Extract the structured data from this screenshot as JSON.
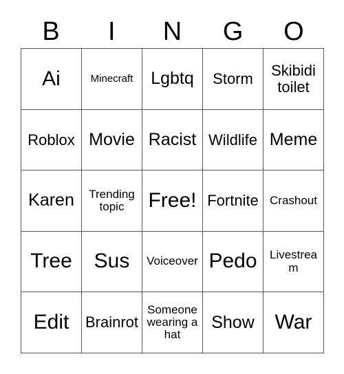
{
  "card": {
    "header_letters": [
      "B",
      "I",
      "N",
      "G",
      "O"
    ],
    "free_space_label": "Free!",
    "colors": {
      "grid_line": "#555555",
      "text": "#000000",
      "background": "#ffffff"
    },
    "rows": [
      [
        {
          "label": "Ai",
          "size": "fs-xl"
        },
        {
          "label": "Minecraft",
          "size": "fs-xs"
        },
        {
          "label": "Lgbtq",
          "size": "fs-lg"
        },
        {
          "label": "Storm",
          "size": "fs-md"
        },
        {
          "label": "Skibidi toilet",
          "size": "fs-md"
        }
      ],
      [
        {
          "label": "Roblox",
          "size": "fs-md"
        },
        {
          "label": "Movie",
          "size": "fs-lg"
        },
        {
          "label": "Racist",
          "size": "fs-lg"
        },
        {
          "label": "Wildlife",
          "size": "fs-md"
        },
        {
          "label": "Meme",
          "size": "fs-lg"
        }
      ],
      [
        {
          "label": "Karen",
          "size": "fs-lg"
        },
        {
          "label": "Trending topic",
          "size": "fs-sm"
        },
        {
          "label": "Free!",
          "size": "fs-xl"
        },
        {
          "label": "Fortnite",
          "size": "fs-md"
        },
        {
          "label": "Crashout",
          "size": "fs-sm"
        }
      ],
      [
        {
          "label": "Tree",
          "size": "fs-xl"
        },
        {
          "label": "Sus",
          "size": "fs-xl"
        },
        {
          "label": "Voiceover",
          "size": "fs-sm"
        },
        {
          "label": "Pedo",
          "size": "fs-xl"
        },
        {
          "label": "Livestream",
          "size": "fs-sm"
        }
      ],
      [
        {
          "label": "Edit",
          "size": "fs-xl"
        },
        {
          "label": "Brainrot",
          "size": "fs-md"
        },
        {
          "label": "Someone wearing a hat",
          "size": "fs-sm"
        },
        {
          "label": "Show",
          "size": "fs-lg"
        },
        {
          "label": "War",
          "size": "fs-xl"
        }
      ]
    ]
  }
}
